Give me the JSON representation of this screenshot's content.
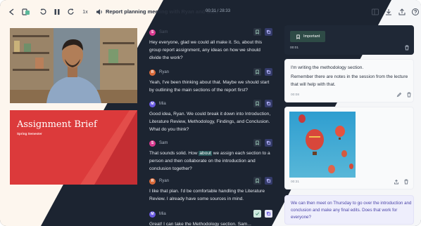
{
  "header": {
    "title": "Report planning meeting with Ryan and Sam",
    "time": "00:31 / 28:33",
    "speed": "1x"
  },
  "slide": {
    "title": "Assignment Brief",
    "subtitle": "Spring Semester"
  },
  "messages": [
    {
      "speaker": "Sam",
      "initial": "S",
      "color": "#d83a8f",
      "text": "Hey everyone, glad we could all make it. So, about this group report assignment, any ideas on how we should divide the work?"
    },
    {
      "speaker": "Ryan",
      "initial": "R",
      "color": "#d86a3a",
      "text": "Yeah, I've been thinking about that. Maybe we should start by outlining the main sections of the report first?"
    },
    {
      "speaker": "Mia",
      "initial": "M",
      "color": "#6a5ae0",
      "text": "Good idea, Ryan. We could break it down into Introduction, Literature Review, Methodology, Findings, and Conclusion. What do you think?"
    },
    {
      "speaker": "Sam",
      "initial": "S",
      "color": "#d83a8f",
      "text_before": "That sounds solid. How ",
      "text_highlight": "about",
      "text_after": " we assign each section to a person and then collaborate on the introduction and conclusion together?"
    },
    {
      "speaker": "Ryan",
      "initial": "R",
      "color": "#d86a3a",
      "text": "I like that plan. I'd be comfortable handling the Literature Review. I already have some sources in mind."
    },
    {
      "speaker": "Mia",
      "initial": "M",
      "color": "#6a5ae0",
      "text": "Great! I can take the Methodology section. Sam..."
    }
  ],
  "notes": [
    {
      "label": "Important",
      "time": "00:01"
    },
    {
      "line1": "I'm writing the methodology section.",
      "line2": "Remember there are notes in the session from the lecture that will help with that.",
      "time": "00:08"
    },
    {
      "time": "00:31"
    },
    {
      "text": "We can then meet on Thursday to go over the introduction and conclusion and make any final edits. Does that work for everyone?"
    }
  ],
  "icons": {
    "back": "back-arrow-icon",
    "logo": "app-logo-icon",
    "pause": "pause-icon",
    "accent": "#5bb89a"
  }
}
